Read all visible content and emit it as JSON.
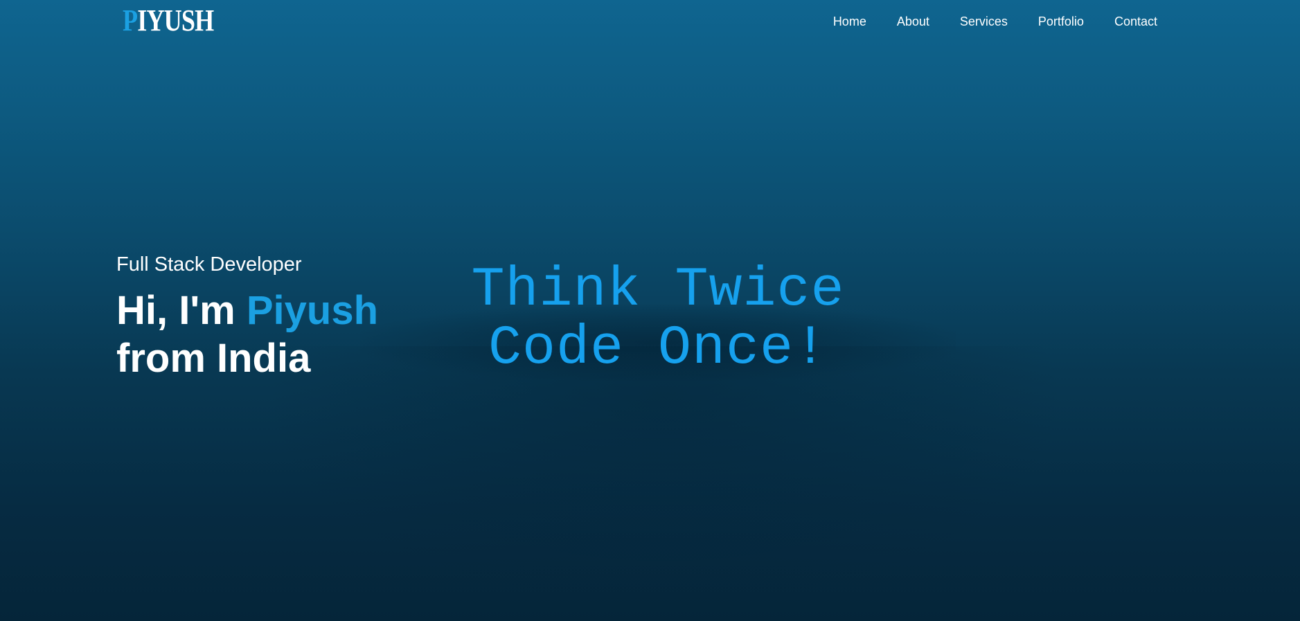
{
  "logo": {
    "first_letter": "P",
    "rest": "IYUSH"
  },
  "nav": {
    "items": [
      {
        "label": "Home"
      },
      {
        "label": "About"
      },
      {
        "label": "Services"
      },
      {
        "label": "Portfolio"
      },
      {
        "label": "Contact"
      }
    ]
  },
  "hero": {
    "subtitle": "Full Stack Developer",
    "greeting": "Hi, I'm",
    "name": "Piyush",
    "location": "from India"
  },
  "tagline": {
    "line1": "Think Twice",
    "line2": "Code Once!"
  },
  "colors": {
    "accent": "#1ba0e2",
    "background_top": "#0f6590",
    "background_bottom": "#052539",
    "text": "#ffffff"
  }
}
